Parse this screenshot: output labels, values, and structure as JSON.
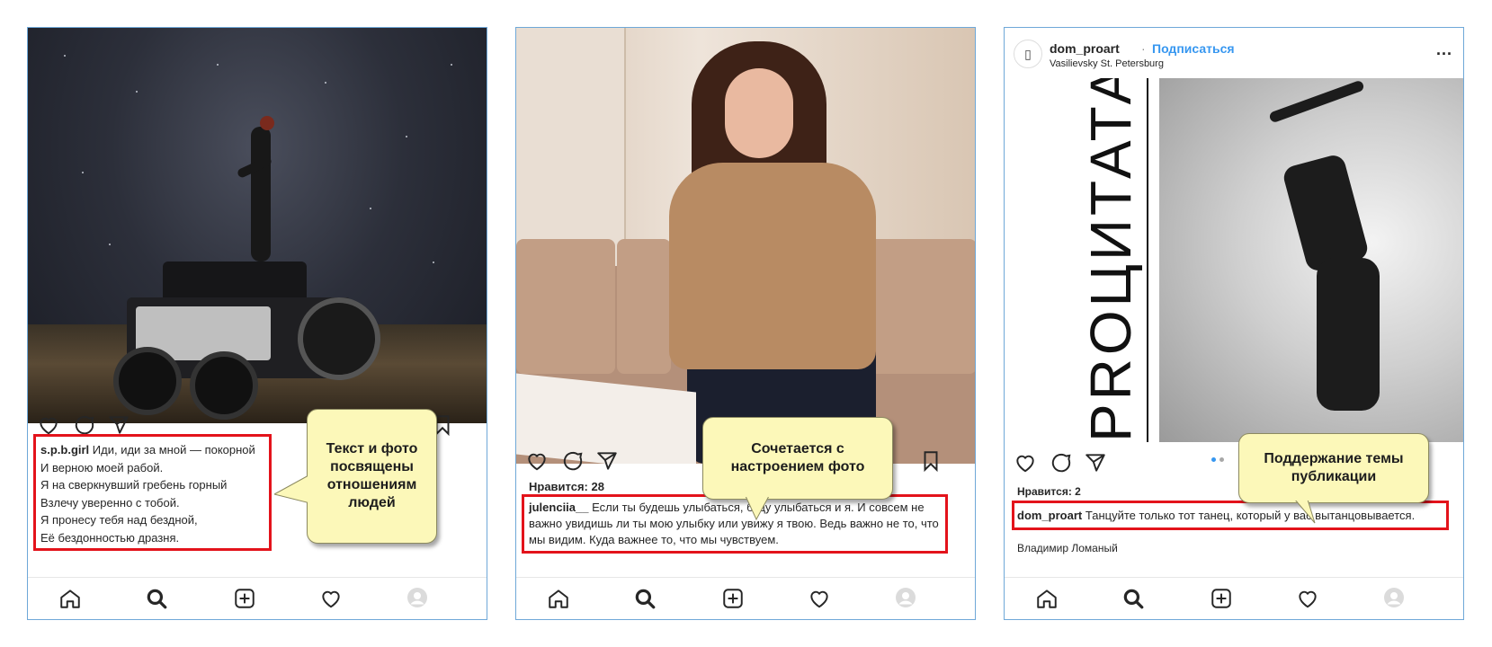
{
  "posts": [
    {
      "username": "s.p.b.girl",
      "caption_lines": [
        "Иди, иди за мной — покорной",
        "И верною моей рабой.",
        "Я на сверкнувший гребень горный",
        "Взлечу уверенно с тобой.",
        "Я пронесу тебя над бездной,",
        "Её бездонностью дразня."
      ],
      "callout": "Текст и фото посвящены отношениям людей"
    },
    {
      "likes": "Нравится: 28",
      "username": "julenciia__",
      "caption": "Если ты будешь улыбаться, буду улыбаться и я. И совсем не важно увидишь ли ты мою улыбку или увижу я твою. Ведь важно не то, что мы видим. Куда важнее то, что мы чувствуем.",
      "callout": "Сочетается с настроением фото"
    },
    {
      "header": {
        "username": "dom_proart",
        "separator": "·",
        "follow_label": "Подписаться",
        "location": "Vasilievsky St. Petersburg",
        "more": "..."
      },
      "image_text": "PROЦИТАТА",
      "likes": "Нравится: 2",
      "username": "dom_proart",
      "caption": "Танцуйте только тот танец, который у вас вытанцовывается.",
      "next_comment": "Владимир Ломаный",
      "callout": "Поддержание темы публикации"
    }
  ],
  "colors": {
    "highlight_border": "#e3131b",
    "callout_fill": "#fcf8b9",
    "link_blue": "#3797f0",
    "panel_border": "#6fa8d8"
  },
  "icons": {
    "actions": [
      "heart-icon",
      "comment-icon",
      "share-icon",
      "bookmark-icon"
    ],
    "nav": [
      "home-icon",
      "search-icon",
      "new-post-icon",
      "activity-heart-icon",
      "profile-avatar-icon"
    ]
  }
}
